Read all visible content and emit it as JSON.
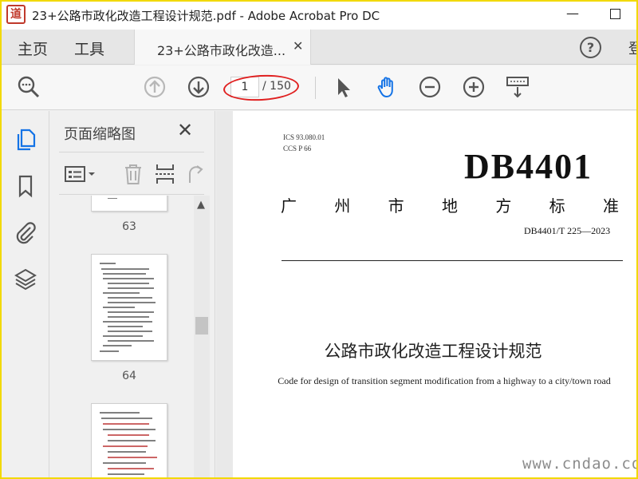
{
  "window": {
    "title": "23+公路市政化改造工程设计规范.pdf - Adobe Acrobat Pro DC",
    "logo_glyph": "道",
    "min_glyph": "—"
  },
  "nav": {
    "home": "主页",
    "tools": "工具",
    "doc_tab_label": "23+公路市政化改造...",
    "close_glyph": "✕",
    "help_glyph": "?",
    "login_partial": "登"
  },
  "toolbar": {
    "page_current": "1",
    "page_total": "/ 150",
    "icons": [
      "zoom-icon",
      "page-up-icon",
      "page-down-icon",
      "select-arrow-icon",
      "hand-tool-icon",
      "zoom-out-icon",
      "zoom-in-icon",
      "keyboard-marquee-icon"
    ]
  },
  "panel": {
    "title": "页面缩略图",
    "close_glyph": "✕",
    "scroll_up_glyph": "▲",
    "thumbnails": [
      {
        "label": "63"
      },
      {
        "label": "64"
      }
    ]
  },
  "document": {
    "meta_ics": "ICS   93.080.01",
    "meta_ccs": "CCS   P  66",
    "std_code": "DB4401",
    "std_sub_chars": [
      "广",
      "州",
      "市",
      "地",
      "方",
      "标",
      "准"
    ],
    "std_number": "DB4401/T 225—2023",
    "title_cn": "公路市政化改造工程设计规范",
    "title_en": "Code for design of transition segment modification from a highway to a city/town road"
  },
  "watermark": "www.cndao.com",
  "colors": {
    "frame": "#f2d900",
    "annotation": "#e02020",
    "accent_blue": "#1473e6"
  }
}
